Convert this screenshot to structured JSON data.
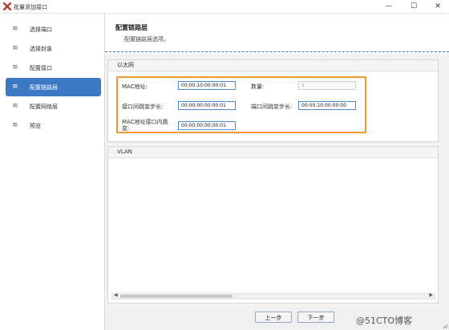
{
  "window": {
    "title": "批量添加接口",
    "minimize_glyph": "—",
    "maximize_glyph": "☐",
    "close_glyph": "✕"
  },
  "sidebar": {
    "items": [
      {
        "label": "选择端口",
        "icon": "menu-lines-icon",
        "active": false
      },
      {
        "label": "选择封装",
        "icon": "menu-lines-icon",
        "active": false
      },
      {
        "label": "配置接口",
        "icon": "menu-lines-icon",
        "active": false
      },
      {
        "label": "配置链路层",
        "icon": "menu-lines-icon",
        "active": true
      },
      {
        "label": "配置网络层",
        "icon": "menu-lines-icon",
        "active": false
      },
      {
        "label": "预览",
        "icon": "menu-lines-icon",
        "active": false
      }
    ]
  },
  "header": {
    "title": "配置链路层",
    "subtitle": "配置链路层选项。"
  },
  "ethernet": {
    "group_title": "以太网",
    "mac_label": "MAC地址:",
    "mac_value": "00:00:10:00:00:01",
    "count_label": "数量:",
    "count_value": "1",
    "port_step_label": "接口间跳变步长:",
    "port_step_value": "00:00:00:00:00:01",
    "card_step_label": "端口间跳变步长:",
    "card_step_value": "00:00:10:00:00:00",
    "intra_step_label_line1": "MAC地址接口内跳",
    "intra_step_label_line2": "变:",
    "intra_step_value": "00:00:00:00:00:01"
  },
  "vlan": {
    "group_title": "VLAN"
  },
  "footer": {
    "prev_label": "上一步",
    "next_label": "下一步"
  },
  "watermark": {
    "text": "@51CTO博客"
  },
  "colors": {
    "accent": "#3c78c4",
    "highlight_border": "#f29838",
    "logo_red": "#c0392b"
  }
}
